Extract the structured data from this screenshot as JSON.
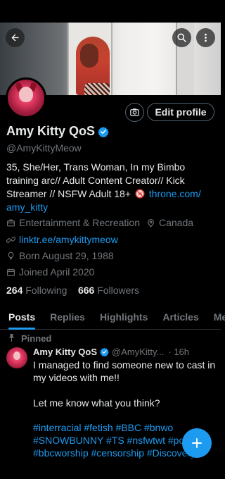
{
  "profile": {
    "name": "Amy Kitty QoS",
    "handle": "@AmyKittyMeow",
    "bio_main": "35, She/Her, Trans Woman, In my Bimbo training arc// Adult Content Creator// Kick Streamer //  NSFW Adult 18+",
    "bio_link": "throne.com/ amy_kitty",
    "category": "Entertainment & Recreation",
    "location": "Canada",
    "website": "linktr.ee/amykittymeow",
    "born": "Born August 29, 1988",
    "joined": "Joined April 2020",
    "following_count": "264",
    "following_label": "Following",
    "followers_count": "666",
    "followers_label": "Followers"
  },
  "actions": {
    "edit_profile": "Edit profile"
  },
  "tabs": [
    {
      "label": "Posts",
      "active": true
    },
    {
      "label": "Replies",
      "active": false
    },
    {
      "label": "Highlights",
      "active": false
    },
    {
      "label": "Articles",
      "active": false
    },
    {
      "label": "Me",
      "active": false
    }
  ],
  "post": {
    "pinned_label": "Pinned",
    "author_name": "Amy Kitty QoS",
    "author_handle": "@AmyKitty...",
    "time": "· 16h",
    "text_1": "I managed to find someone new to cast in my videos with me!!",
    "text_2": "Let me know what you think?",
    "hashtags": "#interracial #fetish #BBC #bnwo #SNOWBUNNY #TS #nsfwtwt #postop #bbcworship #censorship #Discovery"
  },
  "colors": {
    "accent": "#1d9bf0",
    "background": "#000000",
    "muted": "#71767b"
  },
  "icons": {
    "back": "arrow-left-icon",
    "search": "search-icon",
    "more": "more-vertical-icon",
    "camera": "camera-icon",
    "verified": "verified-badge-icon",
    "category": "briefcase-icon",
    "location": "location-pin-icon",
    "link": "link-icon",
    "birthday": "balloon-icon",
    "calendar": "calendar-icon",
    "pin": "pin-icon",
    "compose": "plus-icon"
  }
}
